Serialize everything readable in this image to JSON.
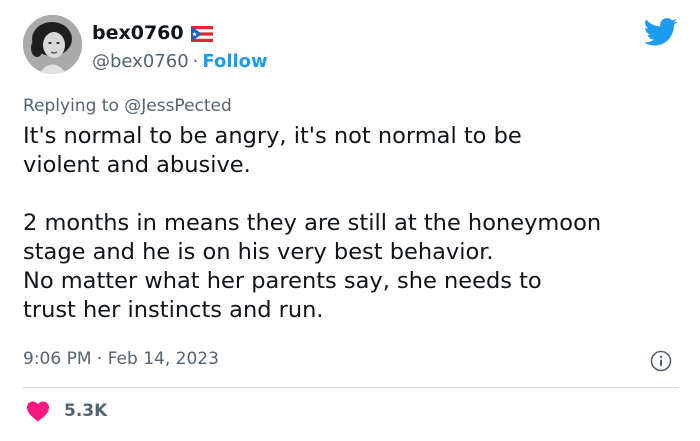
{
  "user": {
    "display_name": "bex0760",
    "handle": "@bex0760",
    "follow_label": "Follow",
    "separator": "·",
    "flag_icon": "puerto-rico-flag-icon"
  },
  "reply": {
    "prefix": "Replying to",
    "handle": "@JessPected"
  },
  "tweet": {
    "text": "It's normal to be angry, it's not normal to be\nviolent and abusive.\n\n2 months in means they are still at the honeymoon\nstage and he is on his very best behavior.\nNo matter what her parents say, she needs to\ntrust her instincts and run.",
    "timestamp": "9:06 PM · Feb 14, 2023"
  },
  "engagement": {
    "likes": "5.3K",
    "like_icon": "heart-icon"
  },
  "icons": {
    "brand": "twitter-bird-icon",
    "info": "info-icon"
  },
  "colors": {
    "accent": "#1d9bf0",
    "secondary_text": "#536471",
    "primary_text": "#0f1419",
    "heart": "#f91880",
    "divider": "#cfd9de"
  }
}
